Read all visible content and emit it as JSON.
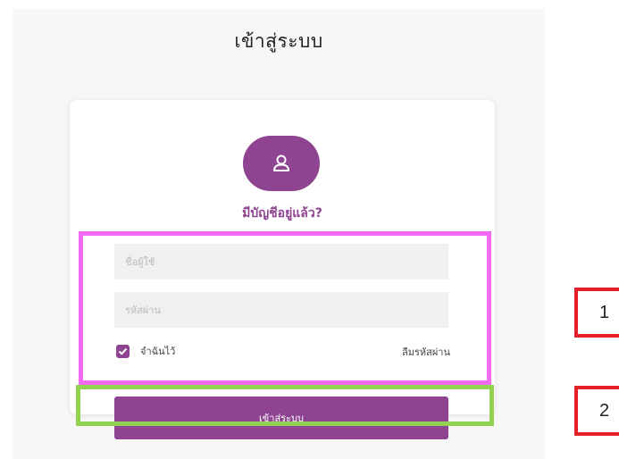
{
  "page": {
    "title": "เข้าสู่ระบบ"
  },
  "login_card": {
    "heading": "มีบัญชีอยู่แล้ว?",
    "username": {
      "placeholder": "ชื่อผู้ใช้",
      "value": ""
    },
    "password": {
      "placeholder": "รหัสผ่าน",
      "value": ""
    },
    "remember_me": {
      "label": "จำฉันไว้",
      "checked": true
    },
    "forgot_password": "ลืมรหัสผ่าน",
    "submit_label": "เข้าสู่ระบบ"
  },
  "annotations": {
    "marker_1": "1",
    "marker_2": "2"
  },
  "colors": {
    "accent": "#8e4490",
    "highlight_pink": "#f36af5",
    "highlight_green": "#93d150",
    "marker_red": "#e5202b"
  },
  "icons": {
    "avatar": "user-icon",
    "checkbox": "check-icon"
  }
}
